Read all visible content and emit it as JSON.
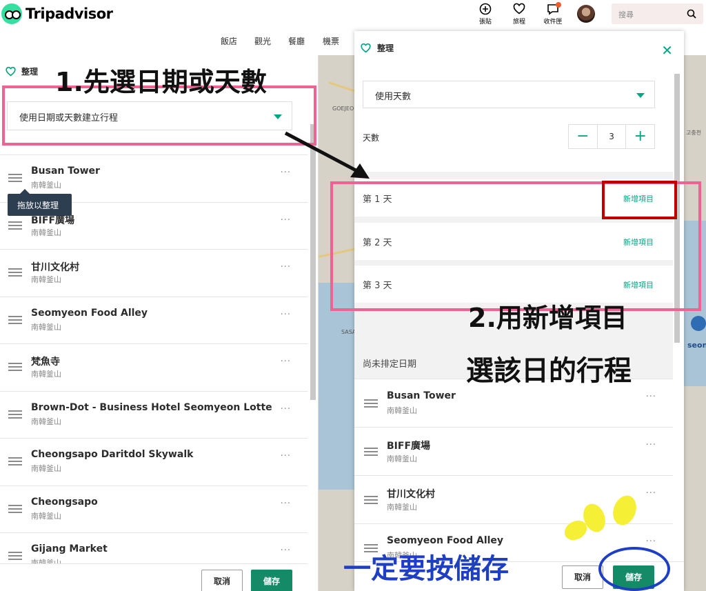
{
  "header": {
    "logo_text": "Tripadvisor",
    "actions": [
      {
        "name": "post",
        "label": "張貼"
      },
      {
        "name": "trips",
        "label": "旅程"
      },
      {
        "name": "inbox",
        "label": "收件匣"
      }
    ],
    "search_placeholder": "搜尋"
  },
  "subnav": [
    "飯店",
    "觀光",
    "餐廳",
    "機票"
  ],
  "left_panel": {
    "title": "整理",
    "select_value": "使用日期或天數建立行程",
    "tooltip": "拖放以整理",
    "items": [
      {
        "name": "Busan Tower",
        "loc": "南韓釜山"
      },
      {
        "name": "BIFF廣場",
        "loc": "南韓釜山"
      },
      {
        "name": "甘川文化村",
        "loc": "南韓釜山"
      },
      {
        "name": "Seomyeon Food Alley",
        "loc": "南韓釜山"
      },
      {
        "name": "梵魚寺",
        "loc": "南韓釜山"
      },
      {
        "name": "Brown-Dot - Business Hotel Seomyeon Lotte",
        "loc": "南韓釜山"
      },
      {
        "name": "Cheongsapo Daritdol Skywalk",
        "loc": "南韓釜山"
      },
      {
        "name": "Cheongsapo",
        "loc": "南韓釜山"
      },
      {
        "name": "Gijang Market",
        "loc": "南韓釜山"
      }
    ],
    "more": "···",
    "cancel": "取消",
    "save": "儲存"
  },
  "modal": {
    "title": "整理",
    "close": "✕",
    "select_value": "使用天數",
    "days_label": "天數",
    "minus": "−",
    "days_value": "3",
    "plus": "+",
    "days": [
      {
        "label": "第 1 天",
        "add": "新增項目"
      },
      {
        "label": "第 2 天",
        "add": "新增項目"
      },
      {
        "label": "第 3 天",
        "add": "新增項目"
      }
    ],
    "unscheduled": "尚未排定日期",
    "items": [
      {
        "name": "Busan Tower",
        "loc": "南韓釜山"
      },
      {
        "name": "BIFF廣場",
        "loc": "南韓釜山"
      },
      {
        "name": "甘川文化村",
        "loc": "南韓釜山"
      },
      {
        "name": "Seomyeon Food Alley",
        "loc": "南韓釜山"
      }
    ],
    "more": "···",
    "cancel": "取消",
    "save": "儲存"
  },
  "map_labels": [
    "GOEJEO",
    "SASA",
    "고충천",
    "seon"
  ],
  "annotations": {
    "step1": "1.先選日期或天數",
    "step2_line1": "2.用新增項目",
    "step2_line2": "選該日的行程",
    "must_save": "一定要按儲存"
  },
  "colors": {
    "accent": "#00a680",
    "save": "#148a66",
    "annotation_pink": "#f06292",
    "annotation_red": "#c00000",
    "annotation_blue": "#1e3fc4"
  }
}
